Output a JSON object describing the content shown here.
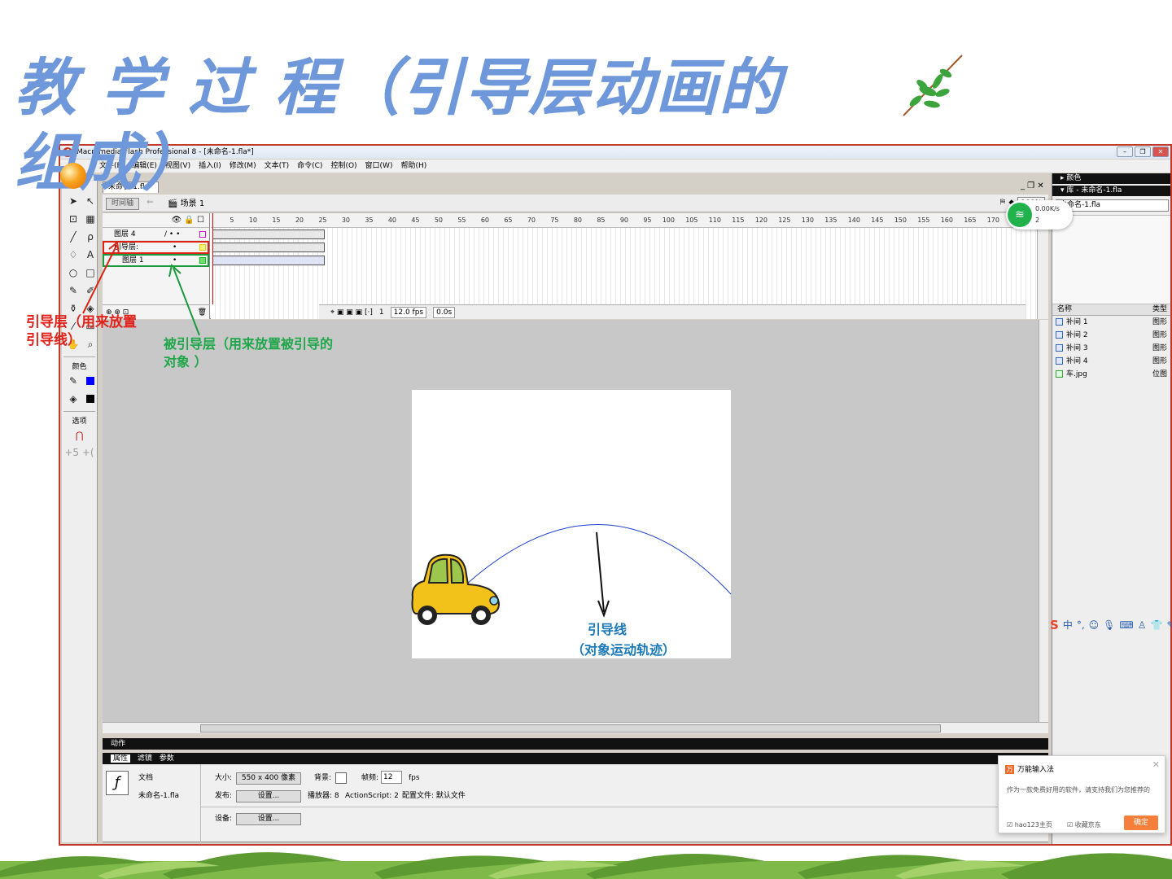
{
  "slide": {
    "title": "教 学 过 程（引导层动画的组成）"
  },
  "window": {
    "title": "Macromedia Flash Professional 8 - [未命名-1.fla*]",
    "menu": [
      "文件(F)",
      "编辑(E)",
      "视图(V)",
      "插入(I)",
      "修改(M)",
      "文本(T)",
      "命令(C)",
      "控制(O)",
      "窗口(W)",
      "帮助(H)"
    ]
  },
  "document": {
    "tab": "未命名-1.fla*",
    "timeline_button": "时间轴",
    "scene": "场景 1",
    "zoom": "100%"
  },
  "timeline": {
    "layers": [
      {
        "name": "图层 4",
        "color": "#d60ed6"
      },
      {
        "name": "引导层:",
        "color": "#e6d200"
      },
      {
        "name": "图层 1",
        "color": "#10c010"
      }
    ],
    "ruler": [
      "5",
      "10",
      "15",
      "20",
      "25",
      "30",
      "35",
      "40",
      "45",
      "50",
      "55",
      "60",
      "65",
      "70",
      "75",
      "80",
      "85",
      "90",
      "95",
      "100",
      "105",
      "110",
      "115",
      "120",
      "125",
      "130",
      "135",
      "140",
      "145",
      "150",
      "155",
      "160",
      "165",
      "170"
    ],
    "current_frame": "1",
    "fps": "12.0 fps",
    "time": "0.0s"
  },
  "toolbox": {
    "colors_label": "颜色",
    "options_label": "选项"
  },
  "panels": {
    "actions": "动作",
    "tabs": [
      "属性",
      "滤镜",
      "参数"
    ]
  },
  "properties": {
    "type": "文档",
    "filename": "未命名-1.fla",
    "size_label": "大小:",
    "size_value": "550 x 400 像素",
    "bg_label": "背景:",
    "fps_label": "帧频:",
    "fps_value": "12",
    "fps_unit": "fps",
    "publish_label": "发布:",
    "settings_button": "设置...",
    "player_label": "播放器: 8",
    "actionscript_label": "ActionScript: 2",
    "profile_label": "配置文件: 默认文件",
    "device_label": "设备:"
  },
  "right_panel": {
    "color_header": "颜色",
    "library_header": "库 - 未命名-1.fla",
    "library_select": "未命名-1.fla",
    "col_name": "名称",
    "col_type": "类型",
    "items": [
      {
        "name": "补间 1",
        "type": "图形"
      },
      {
        "name": "补间 2",
        "type": "图形"
      },
      {
        "name": "补间 3",
        "type": "图形"
      },
      {
        "name": "补间 4",
        "type": "图形"
      },
      {
        "name": "车.jpg",
        "type": "位图"
      }
    ]
  },
  "network_widget": {
    "speed": "0.00K/s",
    "count": "2"
  },
  "popup": {
    "title": "万能输入法",
    "text": "作为一款免费好用的软件，请支持我们为您推荐的",
    "checkbox1": "hao123主页",
    "checkbox2": "收藏京东",
    "confirm": "确定"
  },
  "annotations": {
    "guide_layer": "引导层（用来放置引导线）",
    "guided_layer": "被引导层（用来放置被引导的对象 ）",
    "guide_line": "引导线",
    "guide_line_sub": "（对象运动轨迹）"
  },
  "colors": {
    "title": "#6f98da",
    "annotation_red": "#e0221b",
    "annotation_green": "#1fa64a",
    "annotation_blue": "#1b79b8"
  }
}
